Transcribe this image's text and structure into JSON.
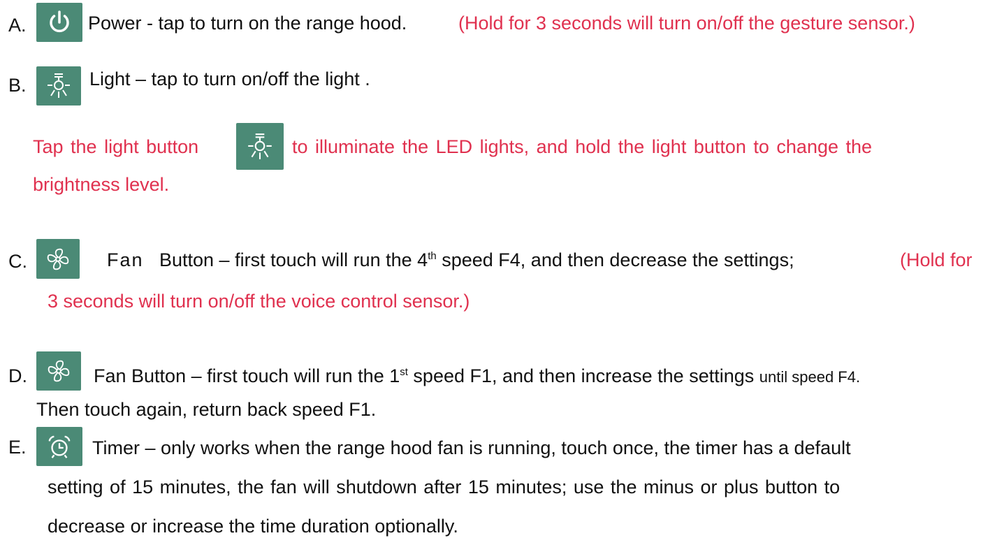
{
  "colors": {
    "icon_bg": "#4b8a76",
    "note_red": "#e0314f",
    "text": "#111111"
  },
  "items": {
    "a": {
      "letter": "A.",
      "icon": "power-icon",
      "text": "Power - tap to turn on the range hood.",
      "note": "(Hold for 3 seconds will turn on/off the gesture sensor.)"
    },
    "b": {
      "letter": "B.",
      "icon": "light-icon",
      "text": "Light – tap to turn on/off the light .",
      "note_line1_pre": "Tap the light button",
      "note_line1_post": "to illuminate the LED lights, and hold the light button to change the",
      "note_line2": "brightness level."
    },
    "c": {
      "letter": "C.",
      "icon": "fan-icon",
      "fan": "Fan",
      "text_pre": "Button – first touch will run the 4",
      "sup": "th",
      "text_post": "speed F4, and then decrease the settings;",
      "note_line1": "(Hold for",
      "note_line2": "3 seconds will turn on/off the voice control sensor.)"
    },
    "d": {
      "letter": "D.",
      "icon": "fan-icon",
      "text_pre": "Fan Button – first touch will run the 1",
      "sup": "st",
      "text_mid": "speed F1, and then increase the settings",
      "text_small": "until speed F4.",
      "line2": "Then touch again, return back speed F1."
    },
    "e": {
      "letter": "E.",
      "icon": "alarm-clock-icon",
      "line1": "Timer – only works when the range hood fan is running, touch once, the timer has a default",
      "line2": "setting of 15 minutes, the fan will shutdown after 15 minutes; use the minus or plus button to",
      "line3": "decrease or increase the time duration optionally."
    }
  }
}
